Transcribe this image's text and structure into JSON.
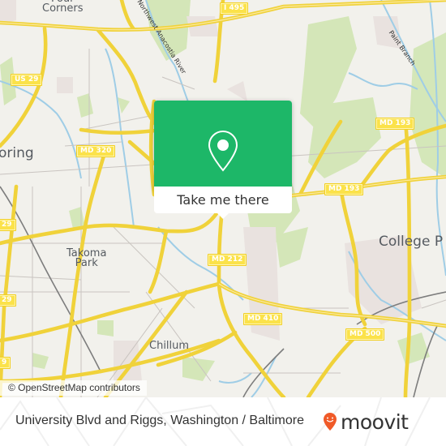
{
  "map": {
    "place_labels": [
      {
        "name": "Four Corners",
        "text": "Four\nCorners"
      },
      {
        "name": "Silver Spring",
        "text": "Silver Spring",
        "visible_text": "oring"
      },
      {
        "name": "Takoma Park",
        "text": "Takoma\nPark"
      },
      {
        "name": "College Park",
        "text": "College P"
      },
      {
        "name": "Chillum",
        "text": "Chillum"
      }
    ],
    "route_shields": [
      {
        "id": "i495",
        "text": "I 495"
      },
      {
        "id": "us29-top",
        "text": "US 29"
      },
      {
        "id": "md320",
        "text": "MD 320"
      },
      {
        "id": "md193-right",
        "text": "MD 193"
      },
      {
        "id": "md193-mid",
        "text": "MD 193"
      },
      {
        "id": "md212",
        "text": "MD 212"
      },
      {
        "id": "md410",
        "text": "MD 410"
      },
      {
        "id": "md500",
        "text": "MD 500"
      },
      {
        "id": "us29-left1",
        "text": "29"
      },
      {
        "id": "us29-left2",
        "text": "29"
      },
      {
        "id": "us29-left3",
        "text": "9"
      }
    ],
    "water_labels": [
      {
        "id": "anacostia",
        "text": "Northwest Anacostia River"
      },
      {
        "id": "paint-branch",
        "text": "Paint Branch"
      }
    ],
    "attribution": "© OpenStreetMap contributors"
  },
  "popup": {
    "icon": "map-pin-icon",
    "action_label": "Take me there",
    "accent_color": "#1db768"
  },
  "footer": {
    "title": "University Blvd and Riggs, Washington / Baltimore",
    "brand": "moovit",
    "brand_color": "#f05a28"
  }
}
